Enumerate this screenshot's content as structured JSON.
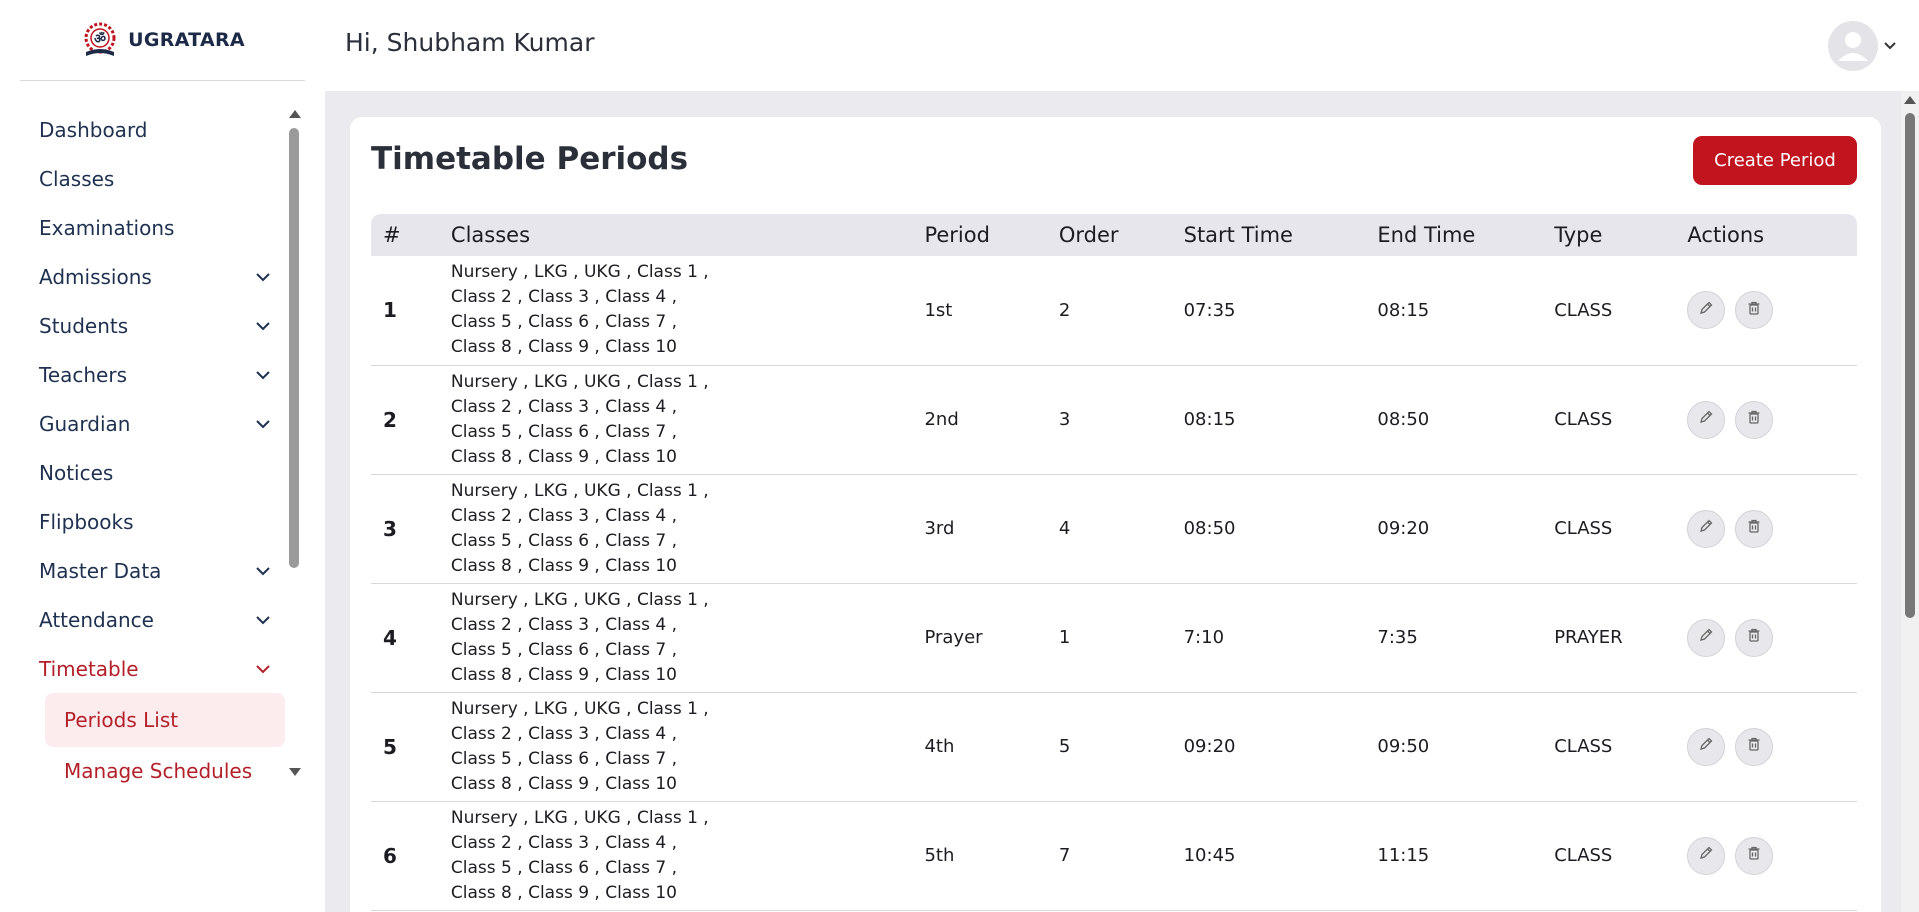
{
  "brand": {
    "name": "UGRATARA"
  },
  "header": {
    "greeting": "Hi, Shubham Kumar"
  },
  "sidebar": {
    "items": [
      {
        "label": "Dashboard",
        "has_chevron": false
      },
      {
        "label": "Classes",
        "has_chevron": false
      },
      {
        "label": "Examinations",
        "has_chevron": false
      },
      {
        "label": "Admissions",
        "has_chevron": true
      },
      {
        "label": "Students",
        "has_chevron": true
      },
      {
        "label": "Teachers",
        "has_chevron": true
      },
      {
        "label": "Guardian",
        "has_chevron": true
      },
      {
        "label": "Notices",
        "has_chevron": false
      },
      {
        "label": "Flipbooks",
        "has_chevron": false
      },
      {
        "label": "Master Data",
        "has_chevron": true
      },
      {
        "label": "Attendance",
        "has_chevron": true
      },
      {
        "label": "Timetable",
        "has_chevron": true,
        "expanded": true
      }
    ],
    "timetable_sub": [
      {
        "label": "Periods List",
        "active": true
      },
      {
        "label": "Manage Schedules",
        "active": false
      }
    ]
  },
  "page": {
    "title": "Timetable Periods",
    "create_button": "Create Period"
  },
  "table": {
    "columns": [
      "#",
      "Classes",
      "Period",
      "Order",
      "Start Time",
      "End Time",
      "Type",
      "Actions"
    ],
    "rows": [
      {
        "idx": "1",
        "classes": "Nursery , LKG , UKG , Class 1 , Class 2 , Class 3 , Class 4 , Class 5 , Class 6 , Class 7 , Class 8 , Class 9 , Class 10",
        "period": "1st",
        "order": "2",
        "start": "07:35",
        "end": "08:15",
        "type": "CLASS"
      },
      {
        "idx": "2",
        "classes": "Nursery , LKG , UKG , Class 1 , Class 2 , Class 3 , Class 4 , Class 5 , Class 6 , Class 7 , Class 8 , Class 9 , Class 10",
        "period": "2nd",
        "order": "3",
        "start": "08:15",
        "end": "08:50",
        "type": "CLASS"
      },
      {
        "idx": "3",
        "classes": "Nursery , LKG , UKG , Class 1 , Class 2 , Class 3 , Class 4 , Class 5 , Class 6 , Class 7 , Class 8 , Class 9 , Class 10",
        "period": "3rd",
        "order": "4",
        "start": "08:50",
        "end": "09:20",
        "type": "CLASS"
      },
      {
        "idx": "4",
        "classes": "Nursery , LKG , UKG , Class 1 , Class 2 , Class 3 , Class 4 , Class 5 , Class 6 , Class 7 , Class 8 , Class 9 , Class 10",
        "period": "Prayer",
        "order": "1",
        "start": "7:10",
        "end": "7:35",
        "type": "PRAYER"
      },
      {
        "idx": "5",
        "classes": "Nursery , LKG , UKG , Class 1 , Class 2 , Class 3 , Class 4 , Class 5 , Class 6 , Class 7 , Class 8 , Class 9 , Class 10",
        "period": "4th",
        "order": "5",
        "start": "09:20",
        "end": "09:50",
        "type": "CLASS"
      },
      {
        "idx": "6",
        "classes": "Nursery , LKG , UKG , Class 1 , Class 2 , Class 3 , Class 4 , Class 5 , Class 6 , Class 7 , Class 8 , Class 9 , Class 10",
        "period": "5th",
        "order": "7",
        "start": "10:45",
        "end": "11:15",
        "type": "CLASS"
      }
    ]
  },
  "icons": {
    "edit": "pencil-icon",
    "delete": "trash-icon",
    "avatar": "user-icon",
    "caret": "chevron-down-icon"
  },
  "colors": {
    "accent": "#c0141f",
    "nav_text": "#1f3150",
    "active_bg": "#fdecee"
  }
}
